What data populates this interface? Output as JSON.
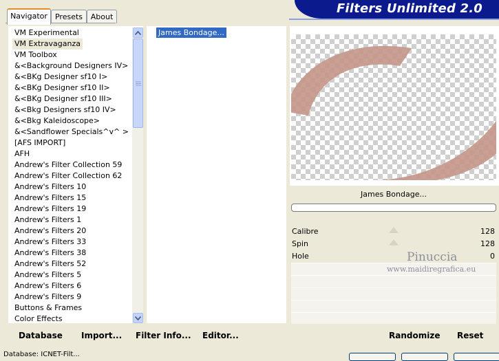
{
  "tabs": [
    {
      "label": "Navigator",
      "active": true
    },
    {
      "label": "Presets",
      "active": false
    },
    {
      "label": "About",
      "active": false
    }
  ],
  "banner": {
    "title": "Filters Unlimited 2.0"
  },
  "categories": [
    "VM Experimental",
    "VM Extravaganza",
    "VM Toolbox",
    "&<Background Designers IV>",
    "&<BKg Designer sf10 I>",
    "&<BKg Designer sf10 II>",
    "&<BKg Designer sf10 III>",
    "&<Bkg Designers sf10 IV>",
    "&<Bkg Kaleidoscope>",
    "&<Sandflower Specials^v^ >",
    "[AFS IMPORT]",
    "AFH",
    "Andrew's Filter Collection 59",
    "Andrew's Filter Collection 62",
    "Andrew's Filters 10",
    "Andrew's Filters 15",
    "Andrew's Filters 19",
    "Andrew's Filters 1",
    "Andrew's Filters 20",
    "Andrew's Filters 33",
    "Andrew's Filters 38",
    "Andrew's Filters 52",
    "Andrew's Filters 5",
    "Andrew's Filters 6",
    "Andrew's Filters 9",
    "Buttons & Frames",
    "Color Effects"
  ],
  "selected_category": "VM Extravaganza",
  "filters": [
    "James Bondage..."
  ],
  "selected_filter": "James Bondage...",
  "preview": {
    "filter_name": "James Bondage...",
    "shape_color": "#c4988a"
  },
  "params": [
    {
      "label": "Calibre",
      "value": "128",
      "slider": 0.5
    },
    {
      "label": "Spin",
      "value": "128",
      "slider": 0.5
    },
    {
      "label": "Hole",
      "value": "0",
      "slider": 0
    }
  ],
  "watermark": {
    "name": "Pinuccia",
    "site": "www.maidiregrafica.eu"
  },
  "buttons": {
    "database": "Database",
    "import": "Import...",
    "filter_info": "Filter Info...",
    "editor": "Editor...",
    "randomize": "Randomize",
    "reset": "Reset"
  },
  "status": "Database:  ICNET-Filt..."
}
